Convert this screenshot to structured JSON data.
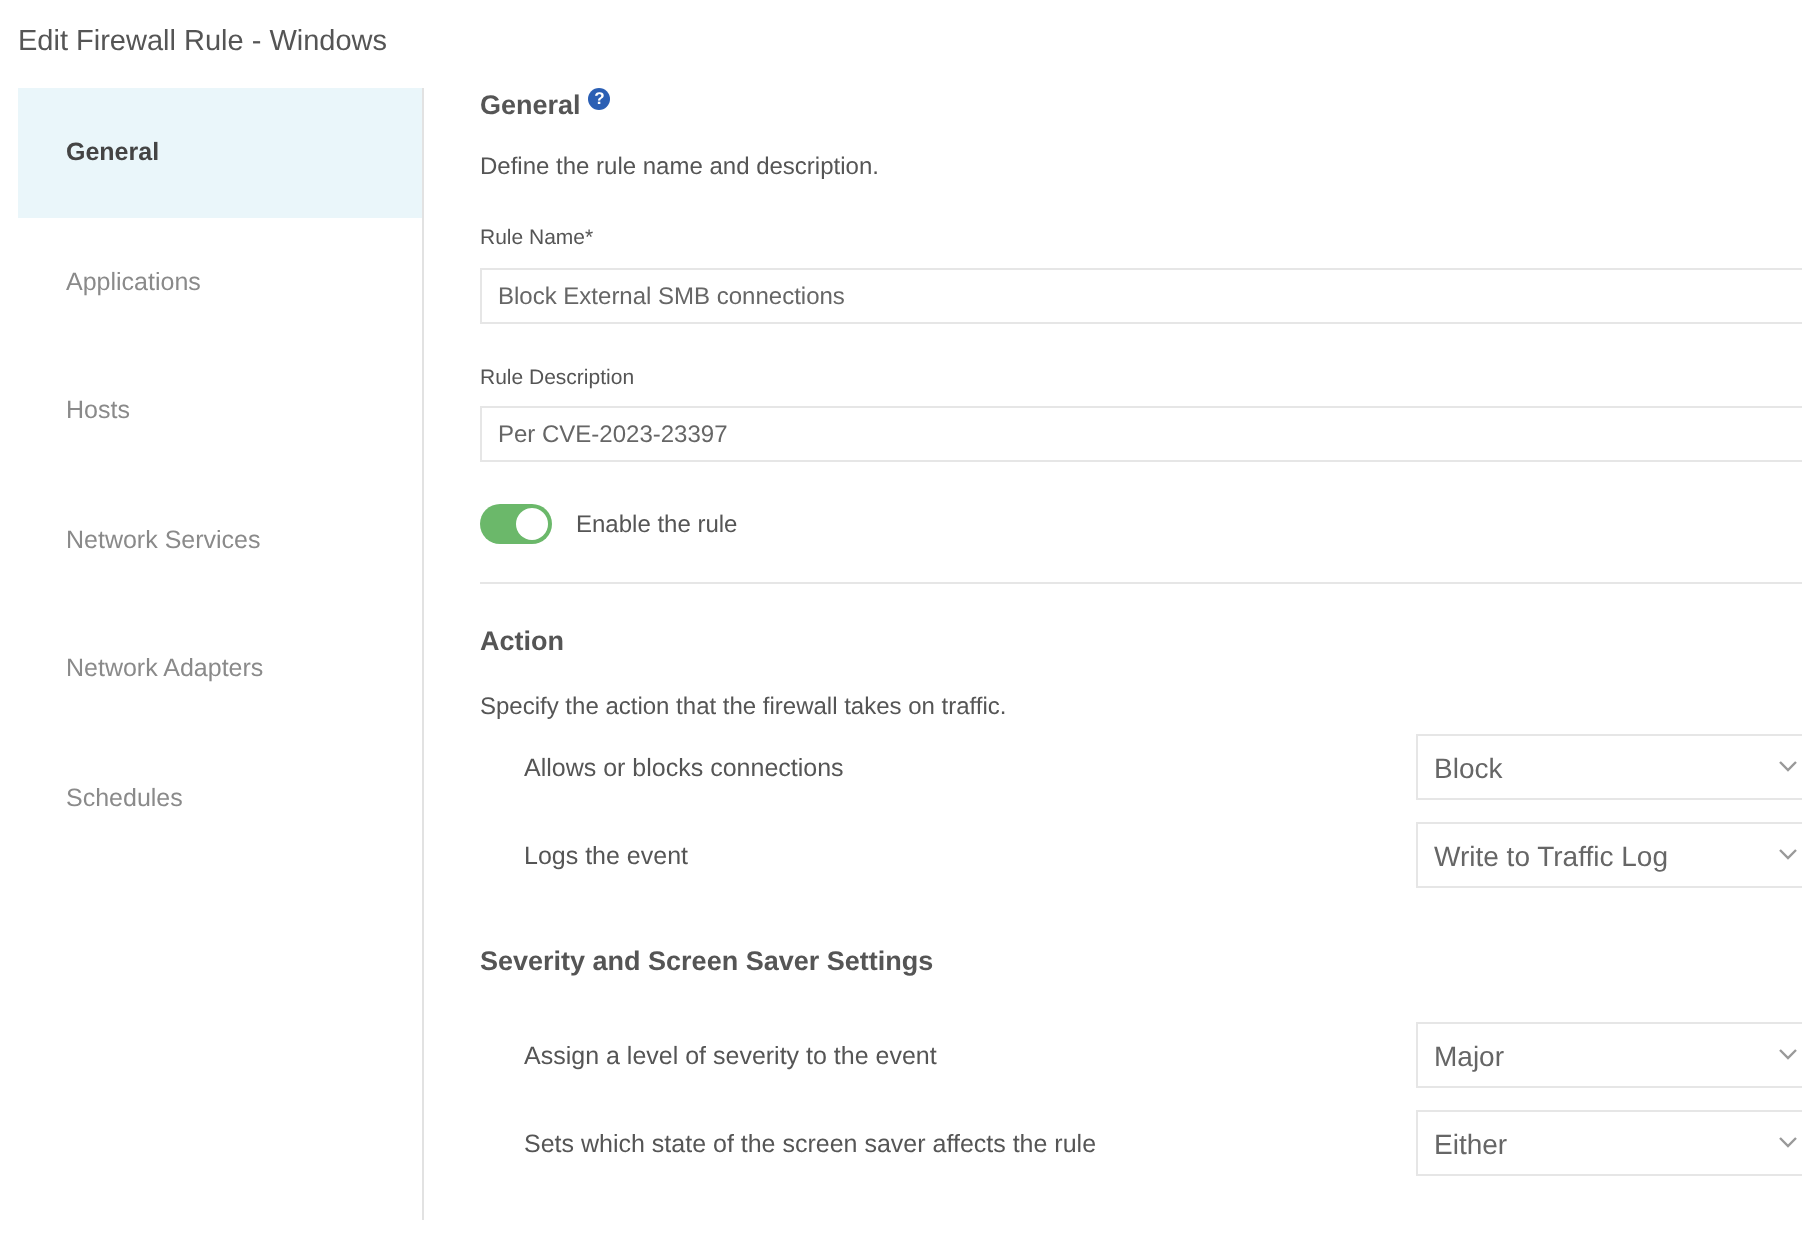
{
  "window": {
    "title": "Edit Firewall Rule - Windows"
  },
  "sidebar": {
    "items": [
      {
        "label": "General",
        "selected": true
      },
      {
        "label": "Applications",
        "selected": false
      },
      {
        "label": "Hosts",
        "selected": false
      },
      {
        "label": "Network Services",
        "selected": false
      },
      {
        "label": "Network Adapters",
        "selected": false
      },
      {
        "label": "Schedules",
        "selected": false
      }
    ]
  },
  "general": {
    "heading": "General",
    "help": "?",
    "description": "Define the rule name and description.",
    "fields": [
      {
        "label": "Rule Name*",
        "value": "Block External SMB connections"
      },
      {
        "label": "Rule Description",
        "value": "Per CVE-2023-23397"
      }
    ],
    "toggle": {
      "label": "Enable the rule",
      "on": true
    }
  },
  "sections": [
    {
      "heading": "Action",
      "description": "Specify the action that the firewall takes on traffic.",
      "settings": [
        {
          "label": "Allows or blocks connections",
          "value": "Block"
        },
        {
          "label": "Logs the event",
          "value": "Write to Traffic Log"
        }
      ]
    },
    {
      "heading": "Severity and Screen Saver Settings",
      "settings": [
        {
          "label": "Assign a level of severity to the event",
          "value": "Major"
        },
        {
          "label": "Sets which state of the screen saver affects the rule",
          "value": "Either"
        }
      ]
    }
  ]
}
